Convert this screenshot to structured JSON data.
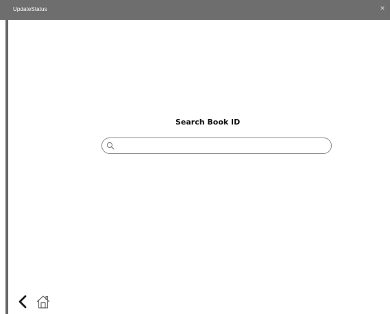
{
  "window": {
    "title": "UpdateStatus",
    "close_symbol": "✕"
  },
  "search": {
    "title": "Search Book ID",
    "value": "",
    "placeholder": "",
    "icon": "search-icon"
  },
  "nav": {
    "back_icon": "chevron-left-icon",
    "home_icon": "home-icon"
  },
  "colors": {
    "titlebar": "#6e6e6e",
    "border": "#666666",
    "background": "#ffffff"
  }
}
